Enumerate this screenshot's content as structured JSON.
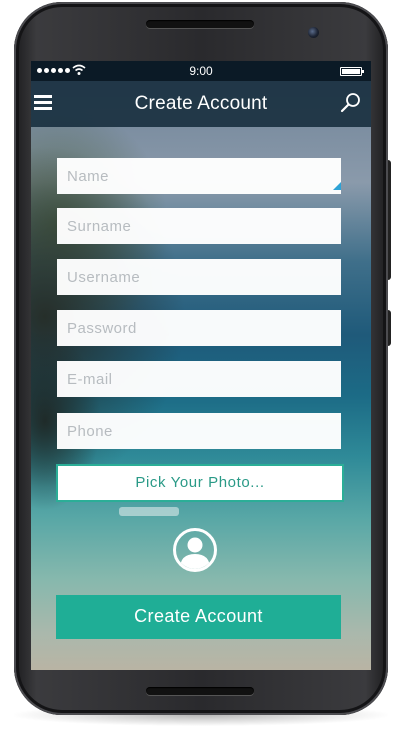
{
  "status_bar": {
    "time": "9:00",
    "signal_icon": "signal-dots-icon",
    "wifi_icon": "wifi-icon",
    "battery_icon": "battery-icon"
  },
  "app_bar": {
    "title": "Create Account",
    "menu_icon": "hamburger-menu-icon",
    "search_icon": "search-icon"
  },
  "form": {
    "fields": [
      {
        "name": "name",
        "placeholder": "Name",
        "value": ""
      },
      {
        "name": "surname",
        "placeholder": "Surname",
        "value": ""
      },
      {
        "name": "username",
        "placeholder": "Username",
        "value": ""
      },
      {
        "name": "password",
        "placeholder": "Password",
        "value": ""
      },
      {
        "name": "email",
        "placeholder": "E-mail",
        "value": ""
      },
      {
        "name": "phone",
        "placeholder": "Phone",
        "value": ""
      }
    ],
    "photo_button_label": "Pick Your Photo...",
    "avatar_icon": "user-avatar-icon",
    "submit_label": "Create Account"
  },
  "colors": {
    "accent": "#1fae96",
    "accent_border": "#2bae97",
    "app_bar": "#162c3c",
    "focus_indicator": "#2ea3d6"
  }
}
